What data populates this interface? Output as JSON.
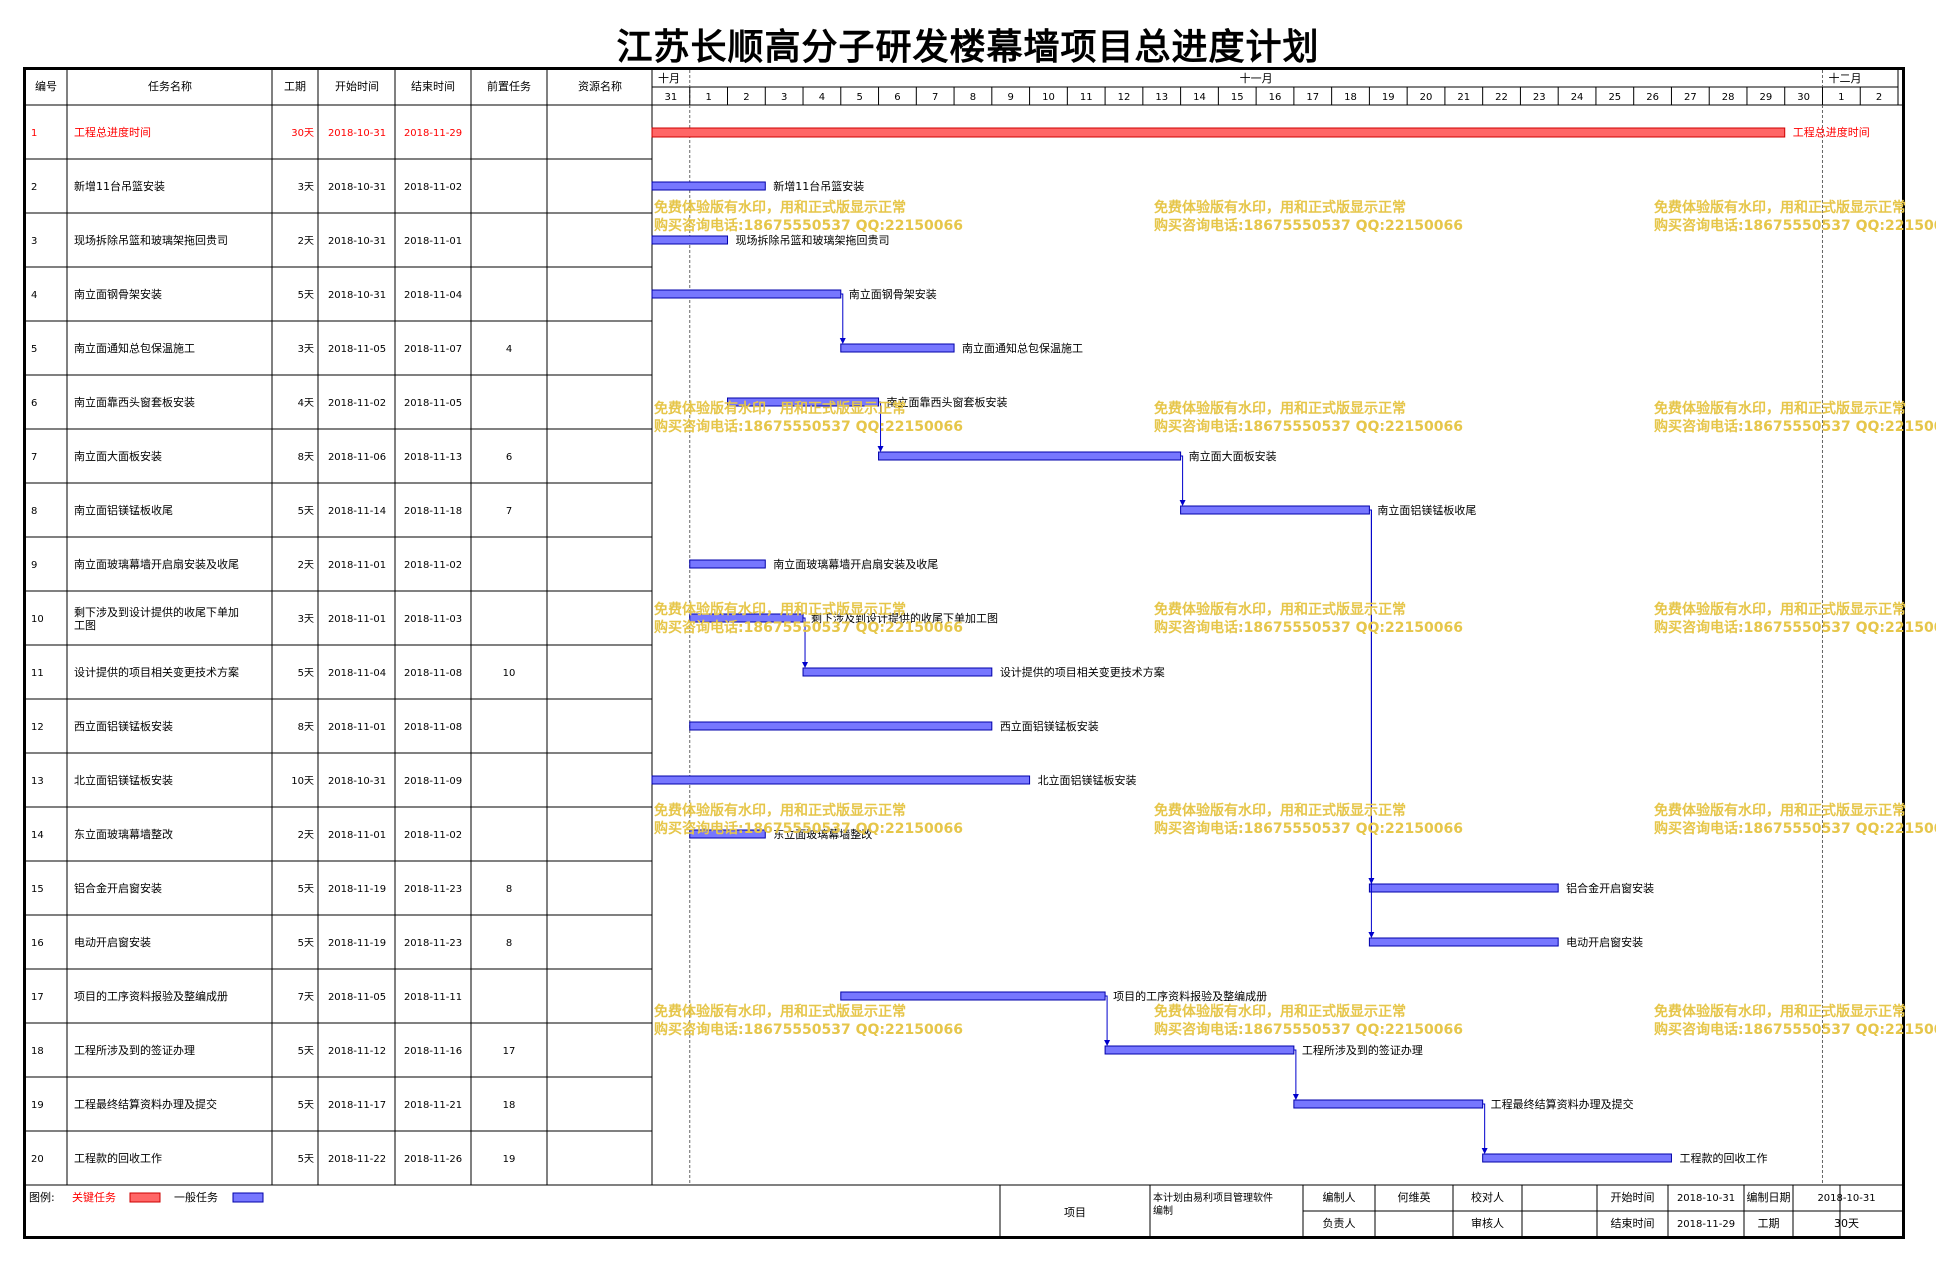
{
  "title": "江苏长顺高分子研发楼幕墙项目总进度计划",
  "table_headers": {
    "id": "编号",
    "name": "任务名称",
    "duration": "工期",
    "start": "开始时间",
    "end": "结束时间",
    "predecessor": "前置任务",
    "resource": "资源名称"
  },
  "months": [
    "十月",
    "十一月",
    "十二月"
  ],
  "day_labels": [
    "31",
    "1",
    "2",
    "3",
    "4",
    "5",
    "6",
    "7",
    "8",
    "9",
    "10",
    "11",
    "12",
    "13",
    "14",
    "15",
    "16",
    "17",
    "18",
    "19",
    "20",
    "21",
    "22",
    "23",
    "24",
    "25",
    "26",
    "27",
    "28",
    "29",
    "30",
    "1",
    "2"
  ],
  "watermark": {
    "line1": "免费体验版有水印，用和正式版显示正常",
    "line2": "购买咨询电话:18675550537 QQ:22150066"
  },
  "colors": {
    "critical": "#ff6666",
    "critical_text": "#ff0000",
    "normal": "#7777ff",
    "link": "#0000cc",
    "watermark": "#e6c64a"
  },
  "chart_data": {
    "type": "gantt",
    "timeline_start": "2018-10-31",
    "timeline_end": "2018-12-02",
    "tasks": [
      {
        "id": "1",
        "name": "工程总进度时间",
        "duration": "30天",
        "start": "2018-10-31",
        "end": "2018-11-29",
        "pred": "",
        "critical": true
      },
      {
        "id": "2",
        "name": "新增11台吊篮安装",
        "duration": "3天",
        "start": "2018-10-31",
        "end": "2018-11-02",
        "pred": "",
        "critical": false
      },
      {
        "id": "3",
        "name": "现场拆除吊篮和玻璃架拖回贵司",
        "duration": "2天",
        "start": "2018-10-31",
        "end": "2018-11-01",
        "pred": "",
        "critical": false
      },
      {
        "id": "4",
        "name": "南立面钢骨架安装",
        "duration": "5天",
        "start": "2018-10-31",
        "end": "2018-11-04",
        "pred": "",
        "critical": false
      },
      {
        "id": "5",
        "name": "南立面通知总包保温施工",
        "duration": "3天",
        "start": "2018-11-05",
        "end": "2018-11-07",
        "pred": "4",
        "critical": false
      },
      {
        "id": "6",
        "name": "南立面靠西头窗套板安装",
        "duration": "4天",
        "start": "2018-11-02",
        "end": "2018-11-05",
        "pred": "",
        "critical": false
      },
      {
        "id": "7",
        "name": "南立面大面板安装",
        "duration": "8天",
        "start": "2018-11-06",
        "end": "2018-11-13",
        "pred": "6",
        "critical": false
      },
      {
        "id": "8",
        "name": "南立面铝镁锰板收尾",
        "duration": "5天",
        "start": "2018-11-14",
        "end": "2018-11-18",
        "pred": "7",
        "critical": false
      },
      {
        "id": "9",
        "name": "南立面玻璃幕墙开启扇安装及收尾",
        "duration": "2天",
        "start": "2018-11-01",
        "end": "2018-11-02",
        "pred": "",
        "critical": false
      },
      {
        "id": "10",
        "name": "剩下涉及到设计提供的收尾下单加工图",
        "duration": "3天",
        "start": "2018-11-01",
        "end": "2018-11-03",
        "pred": "",
        "critical": false
      },
      {
        "id": "11",
        "name": "设计提供的项目相关变更技术方案",
        "duration": "5天",
        "start": "2018-11-04",
        "end": "2018-11-08",
        "pred": "10",
        "critical": false
      },
      {
        "id": "12",
        "name": "西立面铝镁锰板安装",
        "duration": "8天",
        "start": "2018-11-01",
        "end": "2018-11-08",
        "pred": "",
        "critical": false
      },
      {
        "id": "13",
        "name": "北立面铝镁锰板安装",
        "duration": "10天",
        "start": "2018-10-31",
        "end": "2018-11-09",
        "pred": "",
        "critical": false
      },
      {
        "id": "14",
        "name": "东立面玻璃幕墙整改",
        "duration": "2天",
        "start": "2018-11-01",
        "end": "2018-11-02",
        "pred": "",
        "critical": false
      },
      {
        "id": "15",
        "name": "铝合金开启窗安装",
        "duration": "5天",
        "start": "2018-11-19",
        "end": "2018-11-23",
        "pred": "8",
        "critical": false
      },
      {
        "id": "16",
        "name": "电动开启窗安装",
        "duration": "5天",
        "start": "2018-11-19",
        "end": "2018-11-23",
        "pred": "8",
        "critical": false
      },
      {
        "id": "17",
        "name": "项目的工序资料报验及整编成册",
        "duration": "7天",
        "start": "2018-11-05",
        "end": "2018-11-11",
        "pred": "",
        "critical": false
      },
      {
        "id": "18",
        "name": "工程所涉及到的签证办理",
        "duration": "5天",
        "start": "2018-11-12",
        "end": "2018-11-16",
        "pred": "17",
        "critical": false
      },
      {
        "id": "19",
        "name": "工程最终结算资料办理及提交",
        "duration": "5天",
        "start": "2018-11-17",
        "end": "2018-11-21",
        "pred": "18",
        "critical": false
      },
      {
        "id": "20",
        "name": "工程款的回收工作",
        "duration": "5天",
        "start": "2018-11-22",
        "end": "2018-11-26",
        "pred": "19",
        "critical": false
      }
    ]
  },
  "legend": {
    "label": "图例:",
    "critical": "关键任务",
    "normal": "一般任务"
  },
  "footer": {
    "project_label": "项目",
    "software_note": "本计划由易利项目管理软件编制",
    "compiler_label": "编制人",
    "compiler_value": "何维英",
    "checker_label": "校对人",
    "checker_value": "",
    "start_label": "开始时间",
    "start_value": "2018-10-31",
    "date_label": "编制日期",
    "date_value": "2018-10-31",
    "manager_label": "负责人",
    "manager_value": "",
    "reviewer_label": "审核人",
    "reviewer_value": "",
    "end_label": "结束时间",
    "end_value": "2018-11-29",
    "duration_label": "工期",
    "duration_value": "30天"
  }
}
